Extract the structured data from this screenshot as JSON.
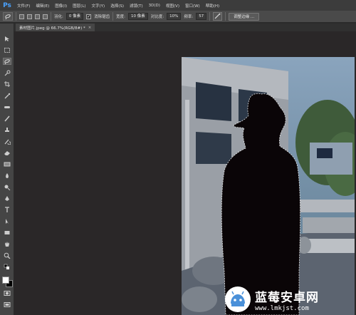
{
  "app": {
    "logo": "Ps"
  },
  "menu": [
    "文件(F)",
    "编辑(E)",
    "图像(I)",
    "图层(L)",
    "文字(Y)",
    "选择(S)",
    "滤镜(T)",
    "3D(D)",
    "视图(V)",
    "窗口(W)",
    "帮助(H)"
  ],
  "options": {
    "feather_label": "羽化:",
    "feather_value": "0 像素",
    "antialias_label": "消除锯齿",
    "antialias_checked": true,
    "width_label": "宽度:",
    "width_value": "10 像素",
    "contrast_label": "对比度:",
    "contrast_value": "10%",
    "frequency_label": "频率:",
    "frequency_value": "57",
    "refine_edge_label": "调整边缘 ..."
  },
  "document": {
    "tab_title": "素材图片.jpeg @ 66.7%(RGB/8#) *",
    "close": "×"
  },
  "toolbox": {
    "icons": [
      "move-icon",
      "marquee-icon",
      "magnetic-lasso-icon",
      "quick-selection-icon",
      "crop-icon",
      "eyedropper-icon",
      "spot-healing-icon",
      "brush-icon",
      "clone-stamp-icon",
      "history-brush-icon",
      "eraser-icon",
      "gradient-icon",
      "blur-icon",
      "dodge-icon",
      "pen-icon",
      "type-icon",
      "path-selection-icon",
      "rectangle-icon",
      "hand-icon",
      "zoom-icon"
    ],
    "foreground_color": "#ffffff",
    "background_color": "#000000"
  },
  "watermark": {
    "title": "蓝莓安卓网",
    "url": "www.lmkjst.com"
  }
}
